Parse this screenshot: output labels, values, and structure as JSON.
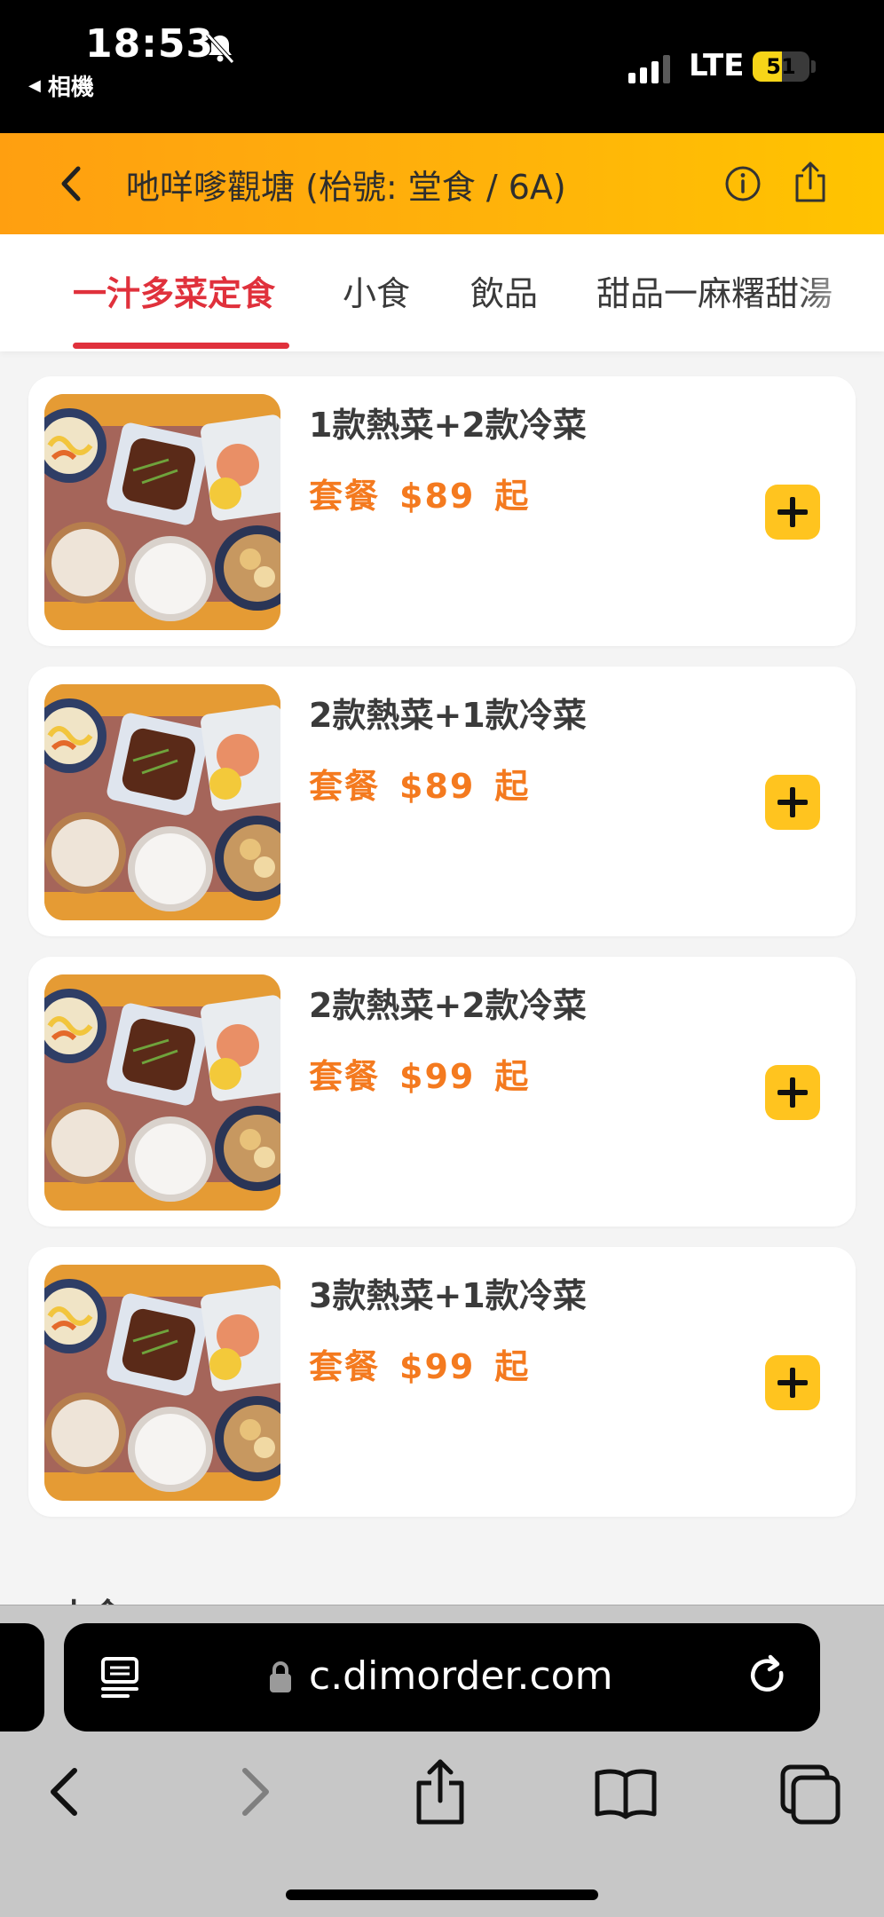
{
  "status_bar": {
    "time": "18:53",
    "back_to_app": "相機",
    "network": "LTE",
    "battery_level": "51",
    "battery_fraction": 0.51
  },
  "header": {
    "back_icon": "chevron-left-icon",
    "title": "吔咩嗲觀塘 (枱號: 堂食 / 6A)",
    "info_icon": "info-icon",
    "share_icon": "share-icon"
  },
  "tabs": [
    {
      "label": "一汁多菜定食",
      "active": true
    },
    {
      "label": "小食",
      "active": false
    },
    {
      "label": "飲品",
      "active": false
    },
    {
      "label": "甜品一麻糬甜湯",
      "active": false
    }
  ],
  "colors": {
    "accent_red": "#e0313c",
    "price_orange": "#f47a1f",
    "add_button_yellow": "#ffc41f",
    "header_gradient_start": "#ff9f10",
    "header_gradient_end": "#ffc400"
  },
  "menu_items": [
    {
      "name": "1款熱菜+2款冷菜",
      "set_label": "套餐",
      "price": "$89",
      "suffix": "起",
      "add_icon": "plus-icon"
    },
    {
      "name": "2款熱菜+1款冷菜",
      "set_label": "套餐",
      "price": "$89",
      "suffix": "起",
      "add_icon": "plus-icon"
    },
    {
      "name": "2款熱菜+2款冷菜",
      "set_label": "套餐",
      "price": "$99",
      "suffix": "起",
      "add_icon": "plus-icon"
    },
    {
      "name": "3款熱菜+1款冷菜",
      "set_label": "套餐",
      "price": "$99",
      "suffix": "起",
      "add_icon": "plus-icon"
    }
  ],
  "next_section_peek": "小食",
  "browser": {
    "url": "c.dimorder.com",
    "reader_icon": "reader-mode-icon",
    "lock_icon": "lock-icon",
    "reload_icon": "reload-icon",
    "toolbar_icons": [
      "back-arrow-icon",
      "forward-arrow-icon",
      "share-icon",
      "bookmarks-icon",
      "tabs-icon"
    ]
  }
}
